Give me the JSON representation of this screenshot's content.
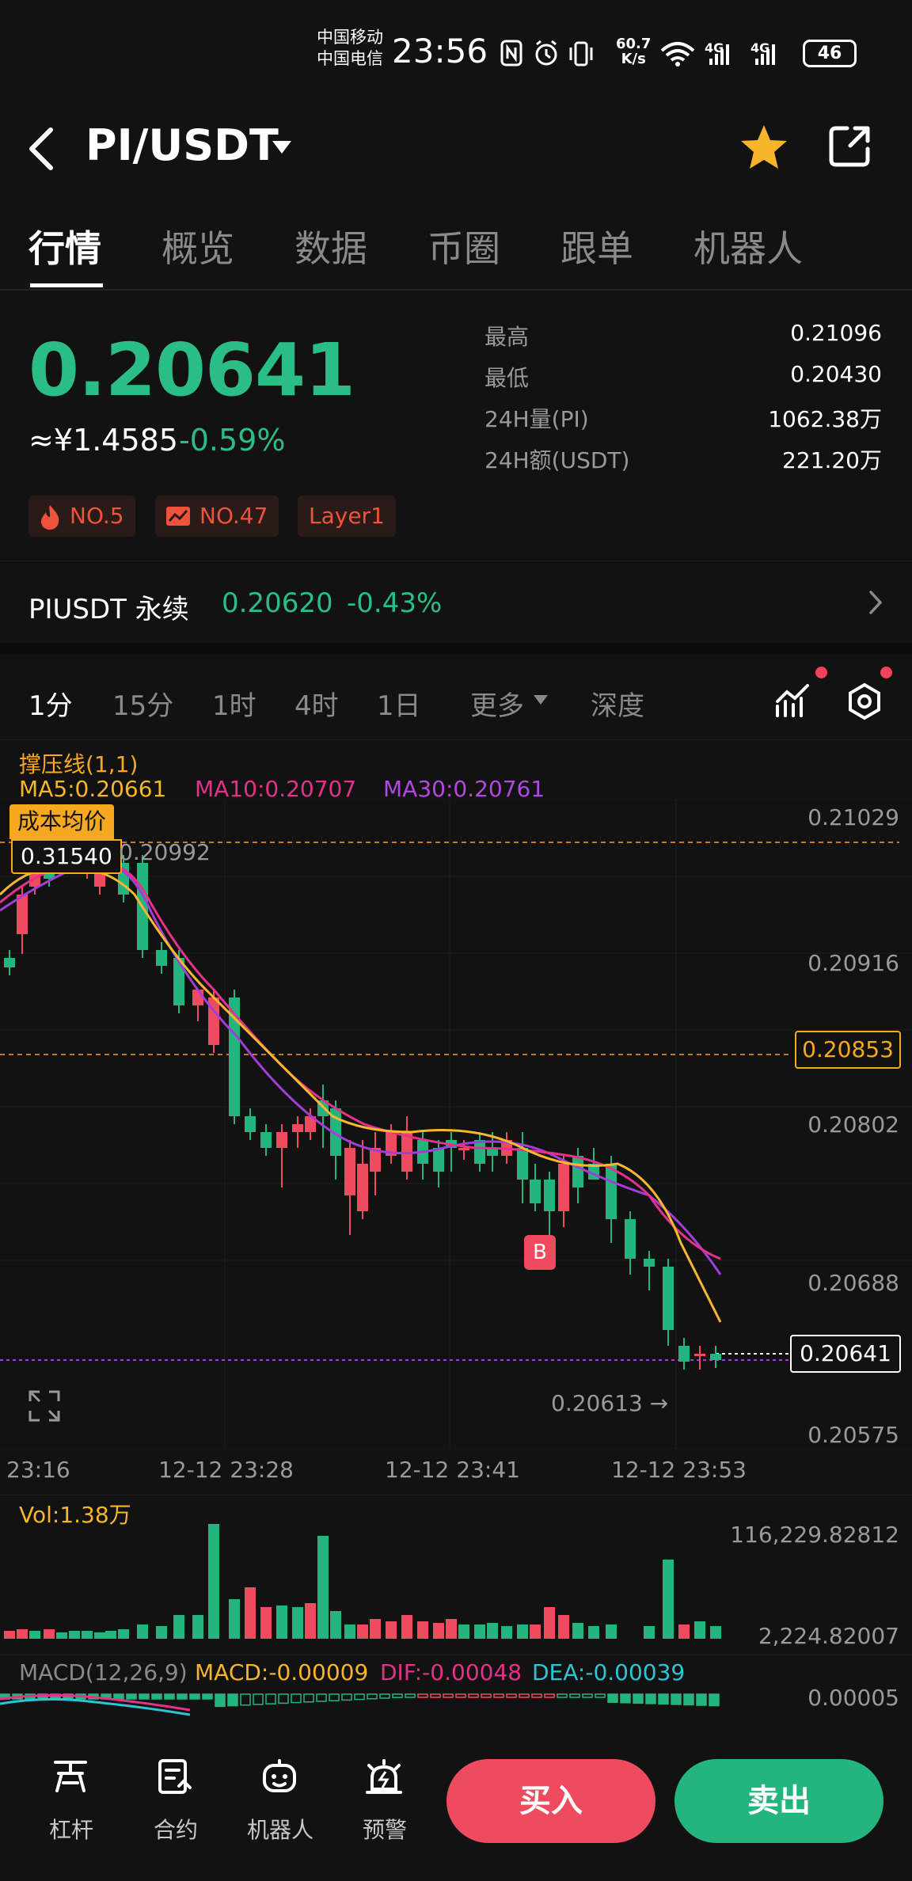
{
  "status_bar": {
    "carrier1": "中国移动",
    "carrier2": "中国电信",
    "time": "23:56",
    "speed_value": "60.7",
    "speed_unit": "K/s",
    "signal1": "4G",
    "signal2": "4G",
    "battery": "46"
  },
  "header": {
    "pair": "PI/USDT"
  },
  "tabs": [
    "行情",
    "概览",
    "数据",
    "币圈",
    "跟单",
    "机器人"
  ],
  "price": {
    "last": "0.20641",
    "cny": "≈¥1.4585",
    "change": "-0.59%"
  },
  "stats": [
    {
      "label": "最高",
      "value": "0.21096"
    },
    {
      "label": "最低",
      "value": "0.20430"
    },
    {
      "label": "24H量(PI)",
      "value": "1062.38万"
    },
    {
      "label": "24H额(USDT)",
      "value": "221.20万"
    }
  ],
  "badges": [
    "NO.5",
    "NO.47",
    "Layer1"
  ],
  "perpetual": {
    "label": "PIUSDT 永续",
    "price": "0.20620",
    "change": "-0.43%"
  },
  "intervals": [
    "1分",
    "15分",
    "1时",
    "4时",
    "1日",
    "更多",
    "深度"
  ],
  "chart_labels": {
    "sr_line": "撑压线(1,1)",
    "ma5": "MA5:0.20661",
    "ma10": "MA10:0.20707",
    "ma30": "MA30:0.20761",
    "cost_avg_label": "成本均价",
    "cost_avg_value": "0.31540",
    "high_mark": "0.20992",
    "low_mark": "0.20613 →",
    "dashed_price": "0.20853",
    "current_price": "0.20641",
    "trade_marker": "B"
  },
  "price_axis": [
    "0.21029",
    "0.20916",
    "0.20802",
    "0.20688",
    "0.20575"
  ],
  "time_axis": [
    "23:16",
    "12-12 23:28",
    "12-12 23:41",
    "12-12 23:53"
  ],
  "volume": {
    "label": "Vol:1.38万",
    "max": "116,229.82812",
    "min": "2,224.82007"
  },
  "macd": {
    "label": "MACD(12,26,9)",
    "macd": "MACD:-0.00009",
    "dif": "DIF:-0.00048",
    "dea": "DEA:-0.00039",
    "axis": "0.00005"
  },
  "bottom_nav": [
    "杠杆",
    "合约",
    "机器人",
    "预警"
  ],
  "actions": {
    "buy": "买入",
    "sell": "卖出"
  },
  "colors": {
    "up": "#ef4b60",
    "down": "#24b47e",
    "ma5": "#f5b82e",
    "ma10": "#e3328a",
    "ma30": "#a23ed8",
    "accent": "#f6a821"
  }
}
